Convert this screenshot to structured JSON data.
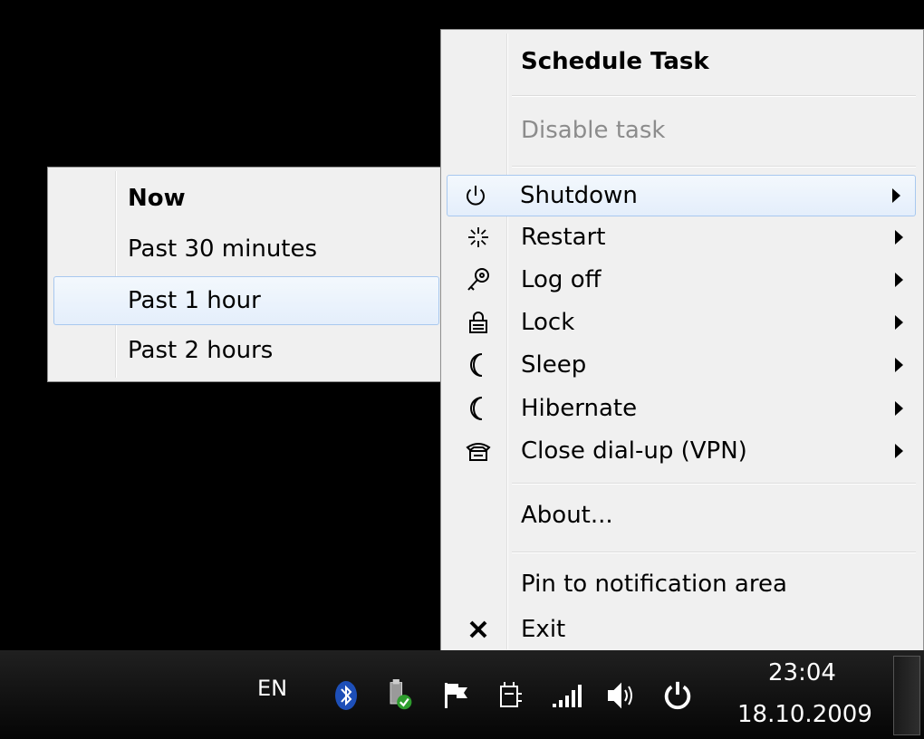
{
  "main_menu": {
    "title": "Schedule Task",
    "disable_label": "Disable task",
    "items": [
      {
        "label": "Shutdown",
        "icon": "power-icon"
      },
      {
        "label": "Restart",
        "icon": "restart-icon"
      },
      {
        "label": "Log off",
        "icon": "key-icon"
      },
      {
        "label": "Lock",
        "icon": "lock-icon"
      },
      {
        "label": "Sleep",
        "icon": "moon-icon"
      },
      {
        "label": "Hibernate",
        "icon": "moon-icon"
      },
      {
        "label": "Close dial-up (VPN)",
        "icon": "telephone-icon"
      }
    ],
    "about_label": "About...",
    "pin_label": "Pin to notification area",
    "exit_label": "Exit"
  },
  "submenu": {
    "items": [
      "Now",
      "Past 30 minutes",
      "Past 1 hour",
      "Past 2 hours"
    ],
    "highlighted": "Past 1 hour"
  },
  "taskbar": {
    "language": "EN",
    "tray_icons": [
      "bluetooth-icon",
      "usb-drive-icon",
      "flag-icon",
      "power-plug-icon",
      "signal-icon",
      "speaker-icon",
      "power-icon"
    ],
    "time": "23:04",
    "date": "18.10.2009"
  },
  "colors": {
    "highlight_border": "#a8c8ef",
    "menu_bg": "#f0f0f0",
    "disabled_text": "#8c8c8c"
  }
}
